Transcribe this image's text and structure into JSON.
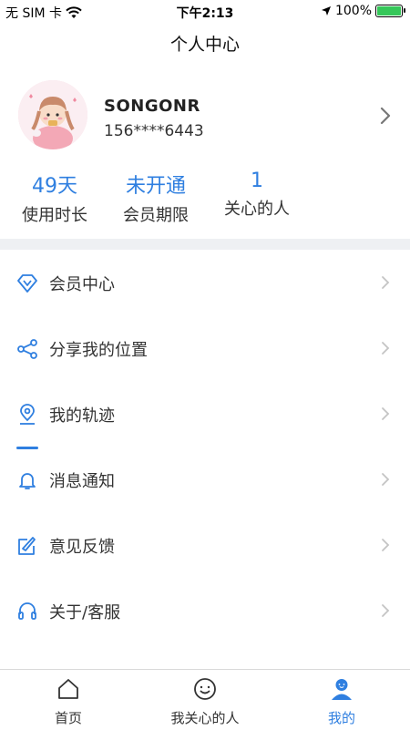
{
  "status_bar": {
    "carrier": "无 SIM 卡",
    "time": "下午2:13",
    "battery": "100%",
    "battery_level": 1.0
  },
  "header": {
    "title": "个人中心"
  },
  "profile": {
    "username": "SONGONR",
    "phone": "156****6443"
  },
  "stats": [
    {
      "value": "49天",
      "label": "使用时长"
    },
    {
      "value": "未开通",
      "label": "会员期限"
    },
    {
      "value": "1",
      "label": "关心的人"
    }
  ],
  "menu": [
    {
      "label": "会员中心",
      "icon": "diamond-icon"
    },
    {
      "label": "分享我的位置",
      "icon": "share-icon"
    },
    {
      "label": "我的轨迹",
      "icon": "location-pin-icon"
    },
    {
      "label": "消息通知",
      "icon": "bell-icon"
    },
    {
      "label": "意见反馈",
      "icon": "feedback-edit-icon"
    },
    {
      "label": "关于/客服",
      "icon": "headset-icon"
    }
  ],
  "tabs": [
    {
      "label": "首页",
      "icon": "home-icon"
    },
    {
      "label": "我关心的人",
      "icon": "smiley-icon"
    },
    {
      "label": "我的",
      "icon": "person-icon",
      "active": true
    }
  ],
  "colors": {
    "accent": "#2f7fe0",
    "band": "#eef0f3",
    "battery": "#35c759"
  }
}
